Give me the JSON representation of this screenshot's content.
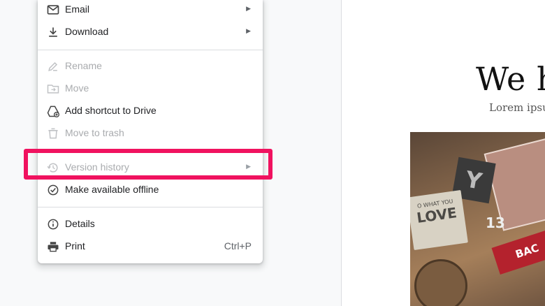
{
  "menu": {
    "items": [
      {
        "label": "Email",
        "icon": "email-icon",
        "submenu": true,
        "disabled": false
      },
      {
        "label": "Download",
        "icon": "download-icon",
        "submenu": true,
        "disabled": false
      },
      {
        "label": "Rename",
        "icon": "rename-icon",
        "disabled": true
      },
      {
        "label": "Move",
        "icon": "move-icon",
        "disabled": true
      },
      {
        "label": "Add shortcut to Drive",
        "icon": "add-shortcut-icon",
        "disabled": false
      },
      {
        "label": "Move to trash",
        "icon": "trash-icon",
        "disabled": true
      },
      {
        "label": "Version history",
        "icon": "history-icon",
        "submenu": true,
        "disabled": true
      },
      {
        "label": "Make available offline",
        "icon": "offline-icon",
        "disabled": false
      },
      {
        "label": "Details",
        "icon": "info-icon",
        "disabled": false
      },
      {
        "label": "Print",
        "icon": "print-icon",
        "shortcut": "Ctrl+P",
        "disabled": false
      }
    ]
  },
  "document": {
    "heading": "We h",
    "subtitle": "Lorem ipsu",
    "image": {
      "card_small": "O WHAT YOU",
      "card_large": "LOVE",
      "block_letter": "Y",
      "pennant": "BAC",
      "number": "13"
    }
  },
  "colors": {
    "highlight": "#f0125f",
    "disabled_text": "#a9abae",
    "menu_text": "#202124"
  }
}
